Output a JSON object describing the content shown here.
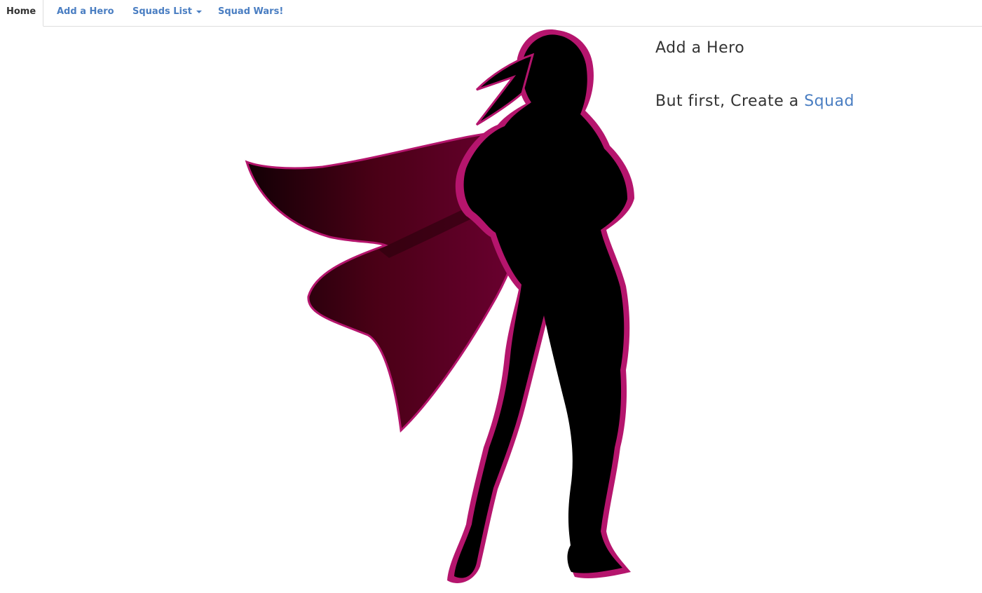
{
  "nav": {
    "tabs": [
      {
        "label": "Home",
        "active": true
      },
      {
        "label": "Add a Hero",
        "active": false
      },
      {
        "label": "Squads List",
        "active": false,
        "dropdown": true
      },
      {
        "label": "Squad Wars!",
        "active": false
      }
    ]
  },
  "main": {
    "heading": "Add a Hero",
    "prompt_text": "But first, Create a ",
    "prompt_link": "Squad"
  },
  "image": {
    "icon": "superheroine-silhouette"
  },
  "colors": {
    "link": "#4a7ec2",
    "text": "#333333",
    "accent_magenta": "#b5156d",
    "cape_dark": "#3a0012"
  }
}
